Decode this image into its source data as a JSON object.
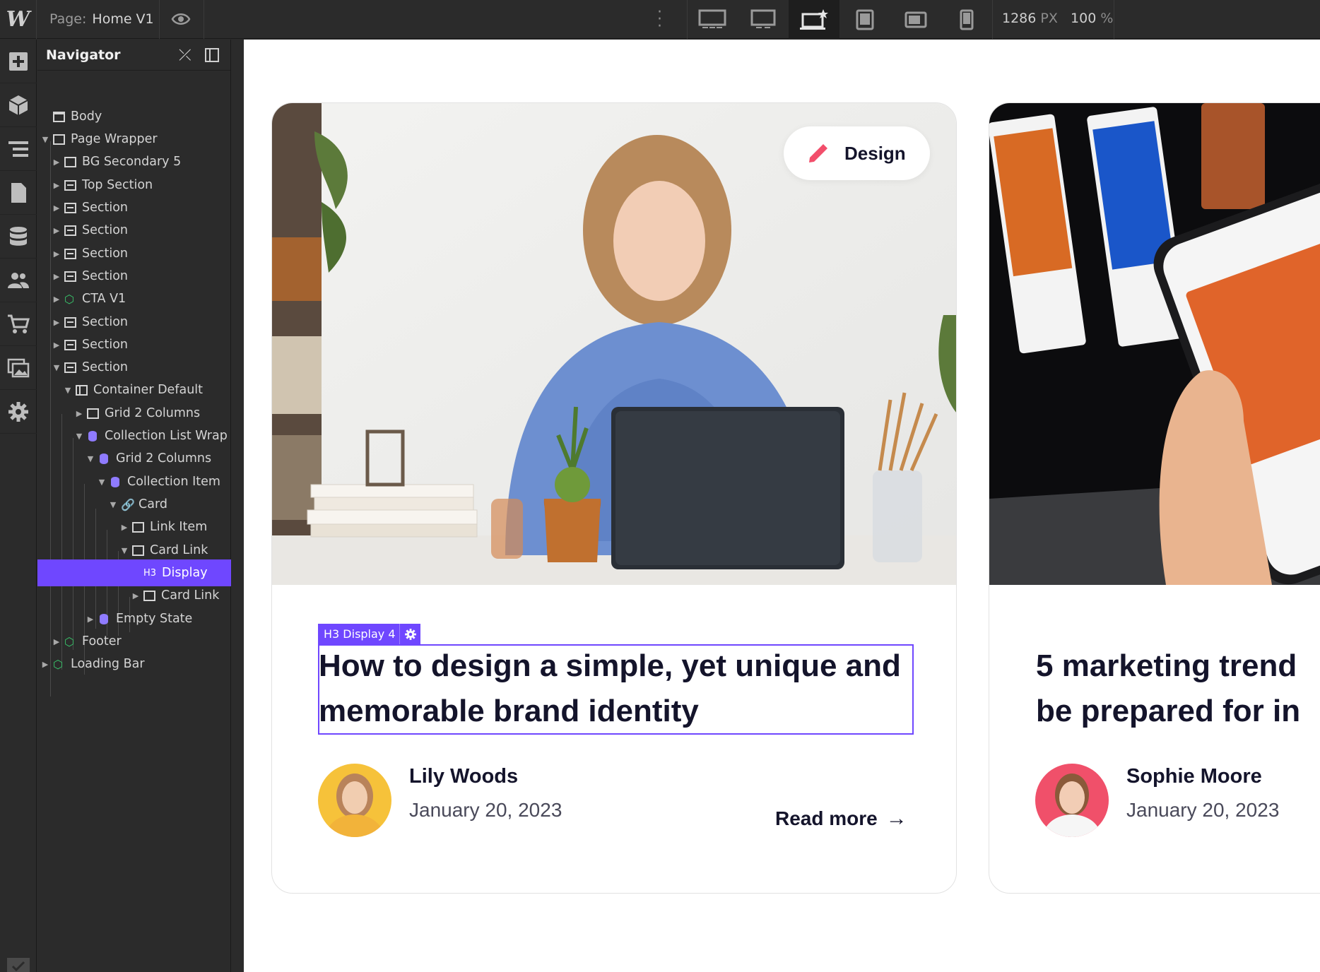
{
  "topbar": {
    "page_label": "Page:",
    "page_name": "Home V1",
    "width_value": "1286",
    "width_unit": "PX",
    "zoom_value": "100",
    "zoom_unit": "%"
  },
  "navigator": {
    "title": "Navigator",
    "items": [
      {
        "label": "Body"
      },
      {
        "label": "Page Wrapper"
      },
      {
        "label": "BG Secondary 5"
      },
      {
        "label": "Top Section"
      },
      {
        "label": "Section"
      },
      {
        "label": "Section"
      },
      {
        "label": "Section"
      },
      {
        "label": "Section"
      },
      {
        "label": "CTA V1"
      },
      {
        "label": "Section"
      },
      {
        "label": "Section"
      },
      {
        "label": "Section"
      },
      {
        "label": "Container Default"
      },
      {
        "label": "Grid 2 Columns"
      },
      {
        "label": "Collection List Wrap"
      },
      {
        "label": "Grid 2 Columns"
      },
      {
        "label": "Collection Item"
      },
      {
        "label": "Card"
      },
      {
        "label": "Link Item"
      },
      {
        "label": "Card Link"
      },
      {
        "label": "Display"
      },
      {
        "label": "Card Link"
      },
      {
        "label": "Empty State"
      },
      {
        "label": "Footer"
      },
      {
        "label": "Loading Bar"
      }
    ],
    "selected_badge": "H3"
  },
  "selection": {
    "tag": "H3 Display 4"
  },
  "cards": [
    {
      "category": "Design",
      "title": "How to design a simple, yet unique and memorable brand identity",
      "author": "Lily Woods",
      "date": "January 20, 2023",
      "read_more": "Read more"
    },
    {
      "title_line1": "5 marketing trend",
      "title_line2": "be prepared for in",
      "author": "Sophie Moore",
      "date": "January 20, 2023"
    }
  ],
  "colors": {
    "accent": "#6f47ff",
    "dark": "#14142b",
    "tag_icon": "#f24e6b"
  }
}
